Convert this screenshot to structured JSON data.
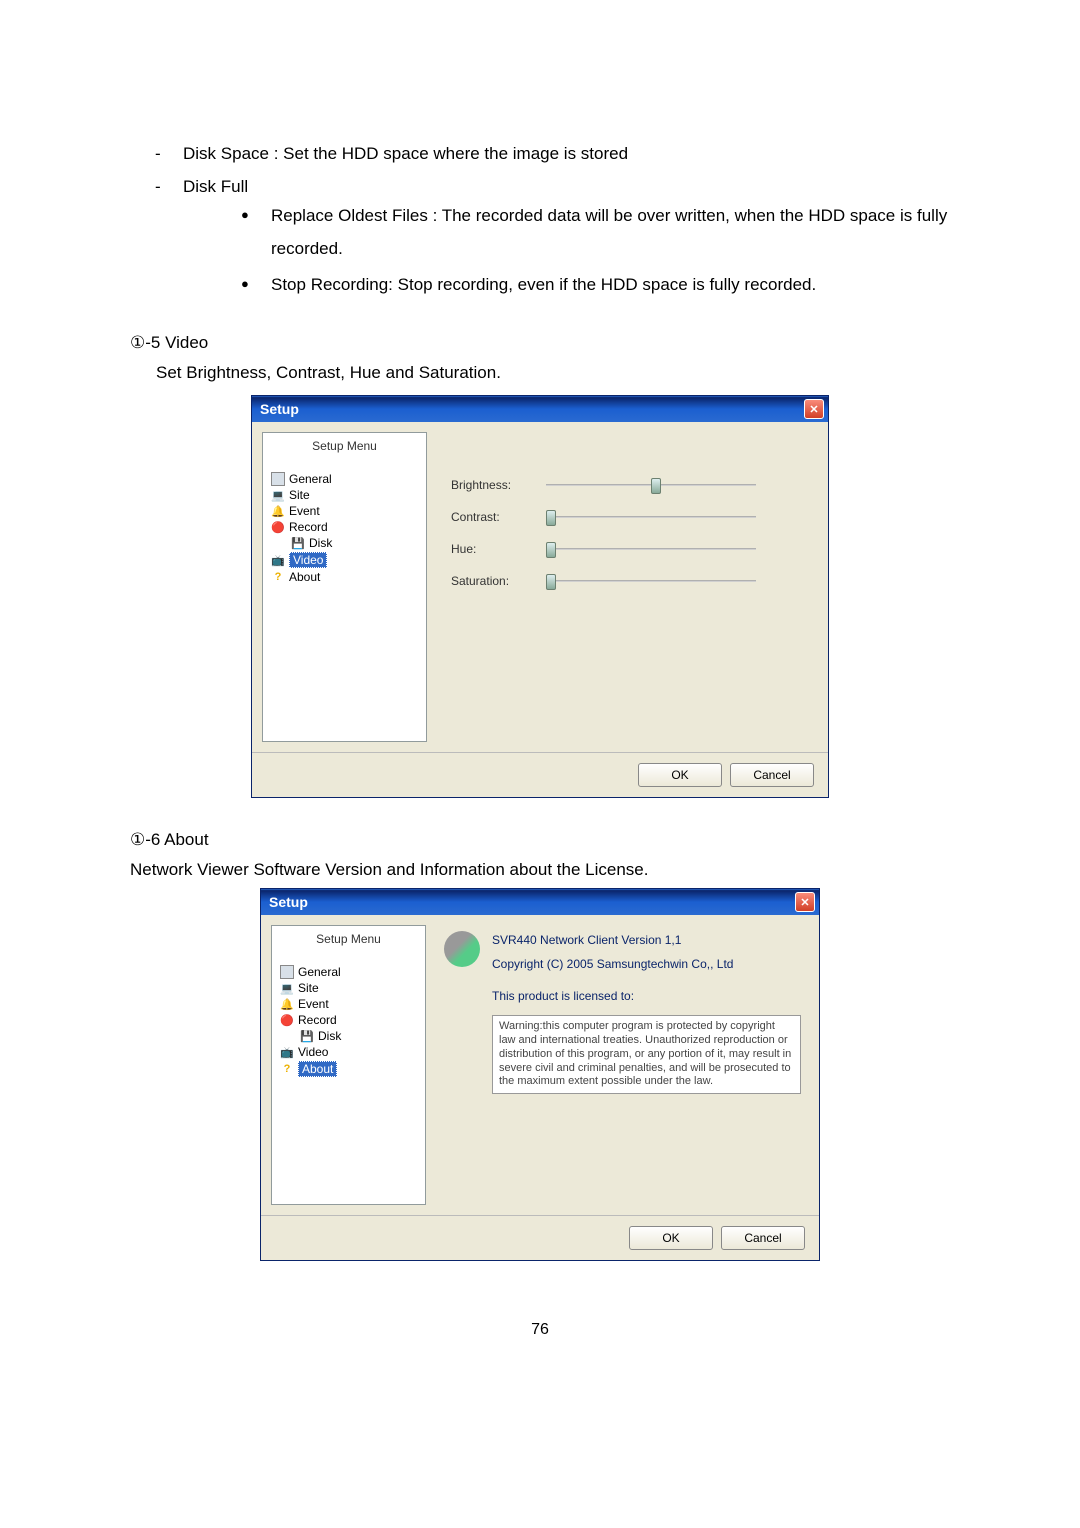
{
  "bullets": {
    "disk_space": "Disk Space : Set the HDD space where the image is stored",
    "disk_full": "Disk Full",
    "replace": "Replace Oldest Files : The recorded data will be over written, when the HDD space is fully recorded.",
    "stop": "Stop Recording: Stop recording, even if the HDD space is fully recorded."
  },
  "section_video": {
    "heading": "①-5 Video",
    "desc": "Set Brightness, Contrast, Hue and Saturation."
  },
  "dialog_video": {
    "title": "Setup",
    "sidebar_title": "Setup Menu",
    "menu": {
      "general": "General",
      "site": "Site",
      "event": "Event",
      "record": "Record",
      "disk": "Disk",
      "video": "Video",
      "about": "About"
    },
    "sliders": {
      "brightness": "Brightness:",
      "contrast": "Contrast:",
      "hue": "Hue:",
      "saturation": "Saturation:"
    },
    "ok": "OK",
    "cancel": "Cancel"
  },
  "section_about": {
    "heading": "①-6 About",
    "desc": "Network Viewer Software Version and Information about the License."
  },
  "dialog_about": {
    "title": "Setup",
    "sidebar_title": "Setup Menu",
    "menu": {
      "general": "General",
      "site": "Site",
      "event": "Event",
      "record": "Record",
      "disk": "Disk",
      "video": "Video",
      "about": "About"
    },
    "version": "SVR440 Network Client Version 1,1",
    "copyright": "Copyright (C) 2005 Samsungtechwin Co,, Ltd",
    "licensed": "This product is licensed to:",
    "warning": "Warning:this computer program is protected by copyright law and international treaties. Unauthorized reproduction or distribution of this program, or any portion of it, may result in severe civil and criminal penalties, and will be prosecuted to the maximum extent possible under the law.",
    "ok": "OK",
    "cancel": "Cancel"
  },
  "page_number": "76"
}
